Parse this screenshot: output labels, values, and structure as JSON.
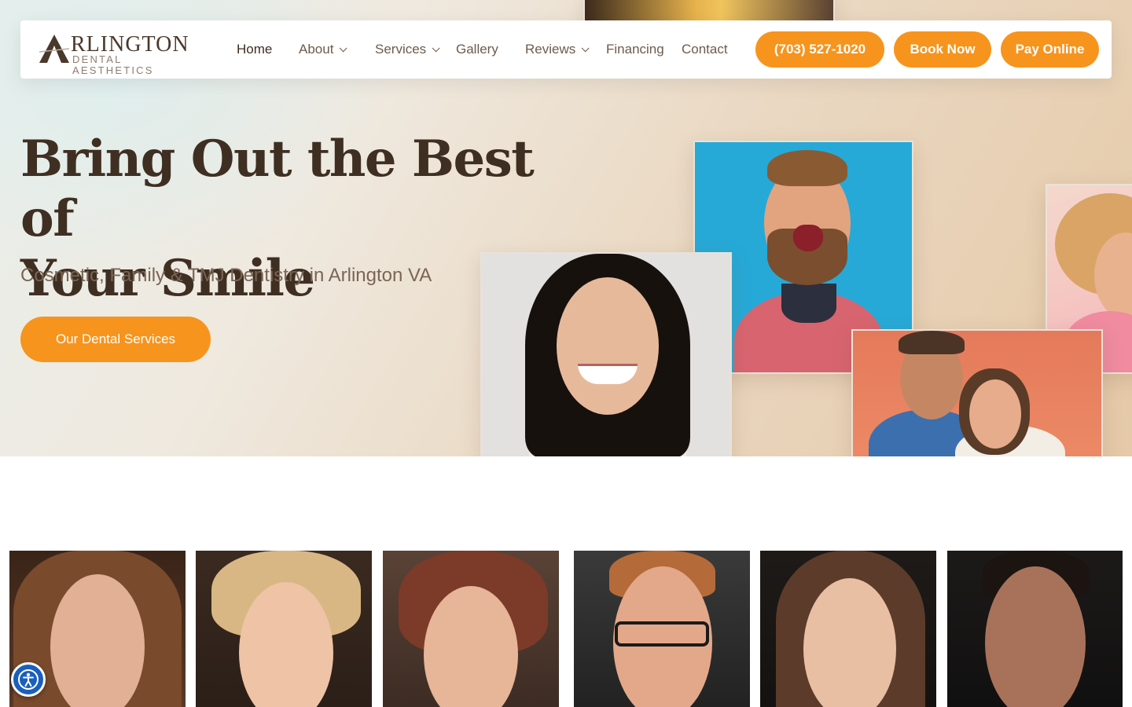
{
  "brand": {
    "name_large": "RLINGTON",
    "name_small": "DENTAL AESTHETICS"
  },
  "nav": {
    "items": [
      {
        "label": "Home",
        "dropdown": false
      },
      {
        "label": "About",
        "dropdown": true
      },
      {
        "label": "Services",
        "dropdown": true
      },
      {
        "label": "Gallery",
        "dropdown": false
      },
      {
        "label": "Reviews",
        "dropdown": true
      },
      {
        "label": "Financing",
        "dropdown": false
      },
      {
        "label": "Contact",
        "dropdown": false
      }
    ],
    "phone": "(703) 527-1020",
    "book": "Book Now",
    "pay": "Pay Online"
  },
  "hero": {
    "title_line1": "Bring Out the Best of",
    "title_line2": "Your Smile",
    "subtitle": "Cosmetic, Family & TMJ Dentistry in Arlington VA",
    "cta": "Our Dental Services"
  },
  "colors": {
    "accent": "#f7941d",
    "heading": "#3f2f22",
    "nav_text": "#6e5a4b"
  },
  "icons": {
    "accessibility": "accessibility-icon",
    "dropdown": "chevron-down-icon"
  }
}
